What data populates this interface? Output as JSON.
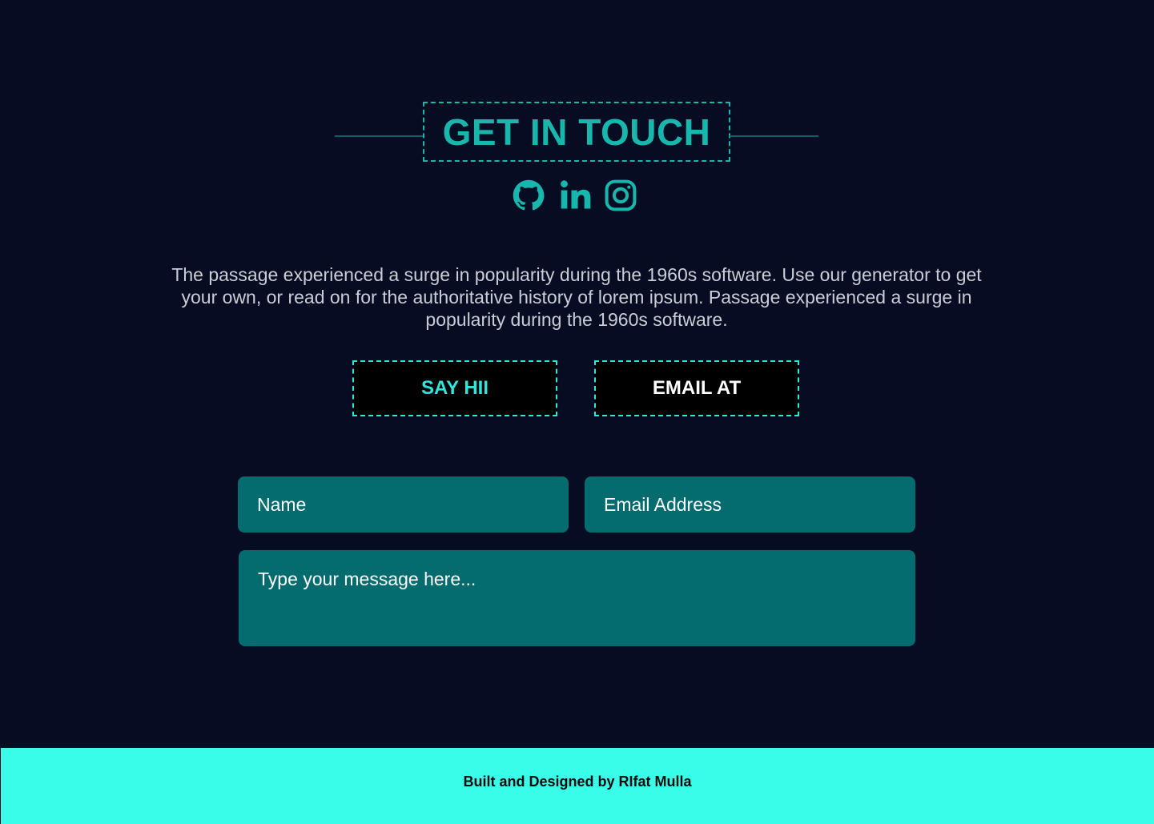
{
  "header": {
    "title": "GET IN TOUCH"
  },
  "socials": [
    {
      "icon": "github-icon"
    },
    {
      "icon": "linkedin-icon"
    },
    {
      "icon": "instagram-icon"
    }
  ],
  "intro": {
    "text": "The passage experienced a surge in popularity during the 1960s software. Use our generator to get your own, or read on for the authoritative history of lorem ipsum. Passage experienced a surge in popularity during the 1960s software."
  },
  "buttons": {
    "say_hi": "SAY HII",
    "email_at": "EMAIL AT"
  },
  "form": {
    "name_placeholder": "Name",
    "email_placeholder": "Email Address",
    "message_placeholder": "Type your message here..."
  },
  "footer": {
    "text": "Built and Designed by RIfat Mulla"
  },
  "colors": {
    "background": "#060c22",
    "accent": "#18b7ad",
    "accent_bright": "#2ee8da",
    "field_bg": "#046b6f",
    "footer_bg": "#39fde9"
  }
}
